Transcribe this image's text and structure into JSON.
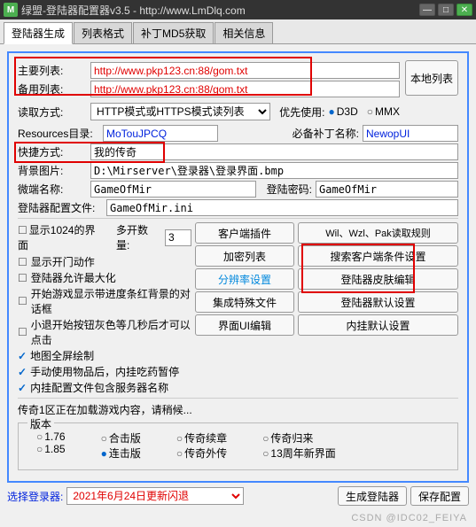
{
  "title": "绿盟-登陆器配置器v3.5  -  http://www.LmDlq.com",
  "tabs": [
    "登陆器生成",
    "列表格式",
    "补丁MD5获取",
    "相关信息"
  ],
  "mainList": {
    "label": "主要列表:",
    "value": "http://www.pkp123.cn:88/gom.txt"
  },
  "backupList": {
    "label": "备用列表:",
    "value": "http://www.pkp123.cn:88/gom.txt"
  },
  "localListBtn": "本地列表",
  "readMode": {
    "label": "读取方式:",
    "value": "HTTP模式或HTTPS模式读列表"
  },
  "priority": {
    "label": "优先使用:",
    "opts": [
      "D3D",
      "MMX"
    ],
    "selected": 0
  },
  "resDir": {
    "label": "Resources目录:",
    "value": "MoTouJPCQ"
  },
  "patchName": {
    "label": "必备补丁名称:",
    "value": "NewopUI"
  },
  "shortcut": {
    "label": "快捷方式:",
    "value": "我的传奇"
  },
  "bgImage": {
    "label": "背景图片:",
    "value": "D:\\Mirserver\\登录器\\登录界面.bmp"
  },
  "microName": {
    "label": "微端名称:",
    "value": "GameOfMir"
  },
  "loginPwd": {
    "label": "登陆密码:",
    "value": "GameOfMir"
  },
  "configFile": {
    "label": "登陆器配置文件:",
    "value": "GameOfMir.ini"
  },
  "checks": {
    "show1024": "显示1024的界面",
    "showOpen": "显示开门动作",
    "allowMax": "登陆器允许最大化",
    "redBg": "开始游戏显示带进度条红背景的对话框",
    "grayBtn": "小退开始按钮灰色等几秒后才可以点击",
    "fullscreen": "地图全屏绘制",
    "autoUse": "手动使用物品后，内挂吃药暂停",
    "includeServer": "内挂配置文件包含服务器名称"
  },
  "multiOpen": {
    "label": "多开数量:",
    "value": "3"
  },
  "buttons": {
    "clientPlugin": "客户端插件",
    "wilRule": "Wil、Wzl、Pak读取规则",
    "encryptList": "加密列表",
    "searchClient": "搜索客户端条件设置",
    "resolution": "分辨率设置",
    "skinEdit": "登陆器皮肤编辑",
    "integrate": "集成特殊文件",
    "defaultLogin": "登陆器默认设置",
    "uiEdit": "界面UI编辑",
    "innerDefault": "内挂默认设置"
  },
  "status": "传奇1区正在加载游戏内容，请稍候...",
  "versionLabel": "版本",
  "versions": {
    "r1": "1.76",
    "r2": "1.85",
    "r3": "合击版",
    "r4": "连击版",
    "r5": "传奇续章",
    "r6": "传奇外传",
    "r7": "传奇归来",
    "r8": "13周年新界面"
  },
  "selectLogin": {
    "label": "选择登录器:",
    "value": "2021年6月24日更新闪退"
  },
  "genBtn": "生成登陆器",
  "saveBtn": "保存配置",
  "watermark": "CSDN @IDC02_FEIYA"
}
